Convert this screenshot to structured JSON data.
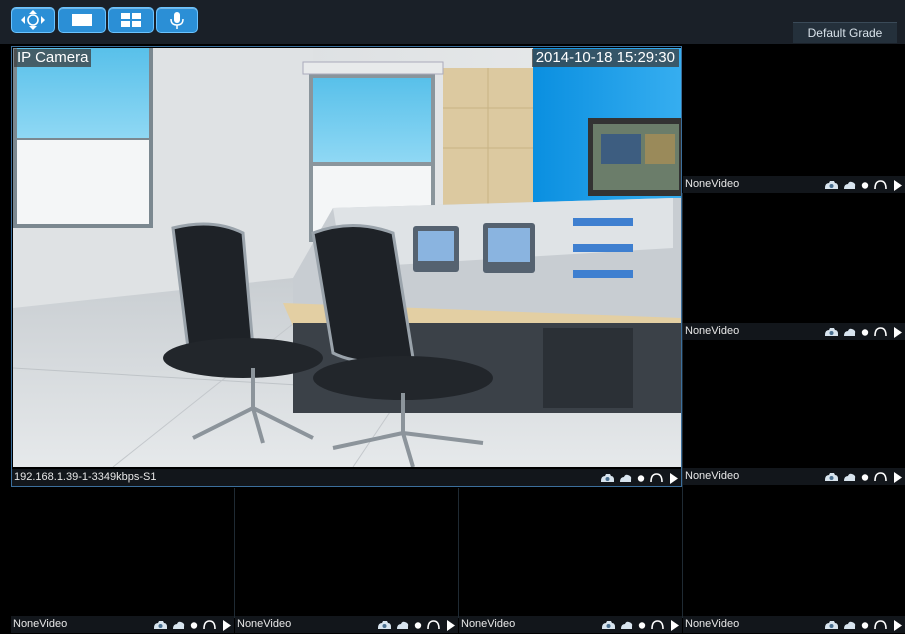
{
  "toolbar": {
    "buttons": [
      "ptz-control",
      "single-view",
      "quad-view",
      "audio"
    ],
    "grade_label": "Default Grade"
  },
  "main_camera": {
    "name": "IP Camera",
    "timestamp": "2014-10-18 15:29:30",
    "status": "192.168.1.39-1-3349kbps-S1"
  },
  "side_cells": [
    {
      "status": "NoneVideo"
    },
    {
      "status": "NoneVideo"
    },
    {
      "status": "NoneVideo"
    }
  ],
  "bottom_cells": [
    {
      "status": "NoneVideo"
    },
    {
      "status": "NoneVideo"
    },
    {
      "status": "NoneVideo"
    },
    {
      "status": "NoneVideo"
    }
  ],
  "colors": {
    "toolbar_bg": "#1a2028",
    "button_blue": "#2b8fd6",
    "status_bg": "#12161b",
    "main_border": "#3c6f9c"
  },
  "status_icons": [
    "snapshot-icon",
    "record-icon",
    "stop-icon",
    "audio-icon",
    "play-icon"
  ]
}
